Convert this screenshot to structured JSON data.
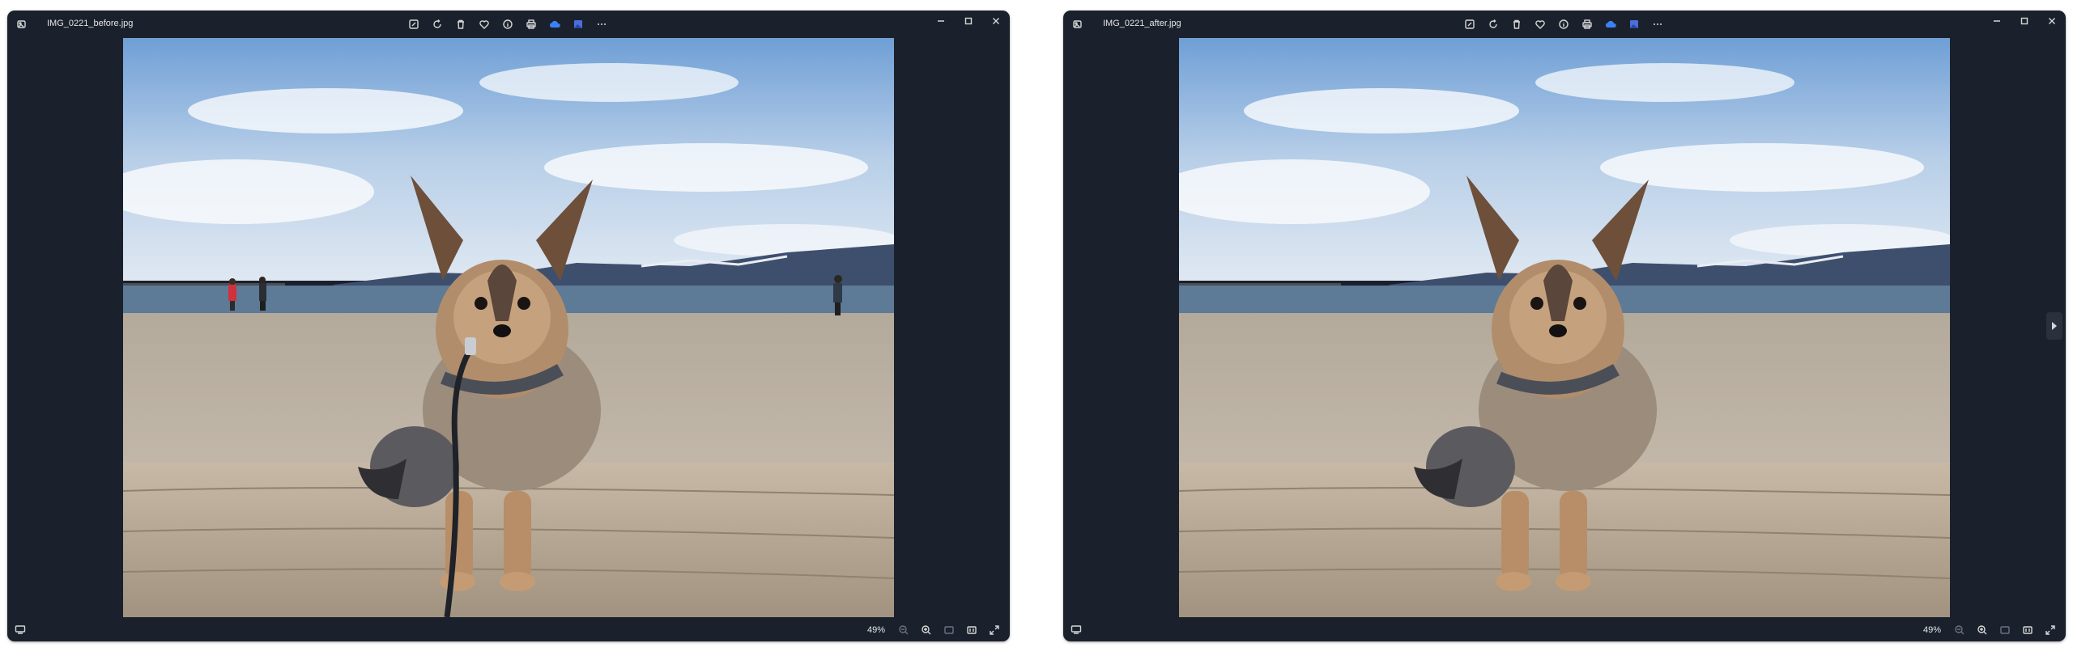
{
  "windows": [
    {
      "filename": "IMG_0221_before.jpg",
      "zoom": "49%",
      "has_people": true,
      "has_leash": true,
      "has_next_arrow": false
    },
    {
      "filename": "IMG_0221_after.jpg",
      "zoom": "49%",
      "has_people": false,
      "has_leash": false,
      "has_next_arrow": true
    }
  ],
  "toolbar_icons": [
    "edit-icon",
    "rotate-icon",
    "delete-icon",
    "favorite-icon",
    "info-icon",
    "print-icon",
    "onedrive-icon",
    "gallery-icon",
    "more-icon"
  ],
  "window_controls": [
    "minimize-icon",
    "maximize-icon",
    "close-icon"
  ],
  "statusbar_icons": [
    "zoom-out-icon",
    "zoom-in-icon",
    "fit-icon",
    "actual-size-icon",
    "fullscreen-icon"
  ],
  "colors": {
    "window_bg": "#1b212c",
    "accent_cloud": "#3b82f6"
  }
}
